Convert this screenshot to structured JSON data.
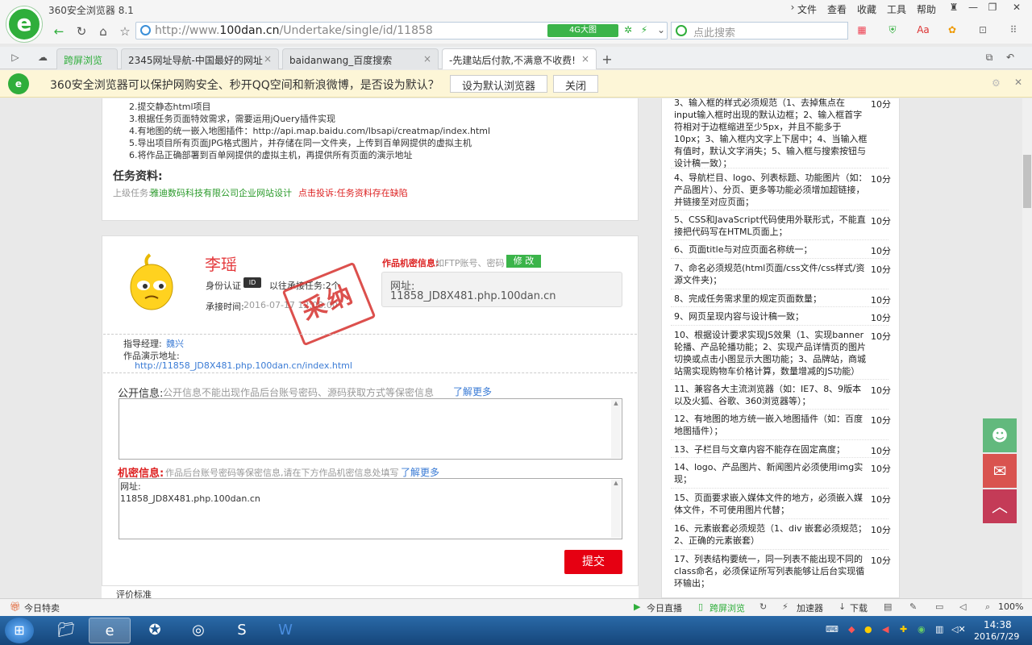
{
  "browser": {
    "title": "360安全浏览器 8.1",
    "menu": [
      "文件",
      "查看",
      "收藏",
      "工具",
      "帮助"
    ],
    "url_prefix": "http://www.",
    "url_domain": "100dan.cn",
    "url_path": "/Undertake/single/id/11858",
    "badge": "4G大图",
    "search_placeholder": "点此搜索",
    "tabs": [
      {
        "label": "跨屏浏览"
      },
      {
        "label": "2345网址导航-中国最好的网址"
      },
      {
        "label": "baidanwang_百度搜索"
      },
      {
        "label": "-先建站后付款,不满意不收费!"
      }
    ],
    "notice": "360安全浏览器可以保护网购安全、秒开QQ空间和新浪微博，是否设为默认？",
    "notice_btn_default": "设为默认浏览器",
    "notice_btn_close": "关闭"
  },
  "task": {
    "steps": [
      "2.提交静态html项目",
      "3.根据任务页面特效需求，需要运用jQuery插件实现",
      "4.有地图的统一嵌入地图插件：http://api.map.baidu.com/lbsapi/creatmap/index.html",
      "5.导出项目所有页面JPG格式图片，并存储在同一文件夹，上传到百单网提供的虚拟主机",
      "6.将作品正确部署到百单网提供的虚拟主机，再提供所有页面的演示地址"
    ],
    "materials_title": "任务资料:",
    "parent_label": "上级任务:",
    "parent_value": "雅迪数码科技有限公司企业网站设计",
    "complaint": "点击投诉:任务资料存在缺陷"
  },
  "submission": {
    "name": "李瑶",
    "identity_label": "身份认证",
    "past_tasks": "以往承接任务:2个",
    "time_label": "承接时间:",
    "time_value": "2016-07-17 12:08:00",
    "stamp": "采纳",
    "secret_label": "作品机密信息:",
    "secret_hint": "如FTP账号、密码",
    "edit_btn": "修 改",
    "url_label": "网址:",
    "url_value": "11858_JD8X481.php.100dan.cn",
    "manager_label": "指导经理:",
    "manager_value": "魏兴",
    "demo_label": "作品演示地址:",
    "demo_url": "http://11858_JD8X481.php.100dan.cn/index.html",
    "public_label": "公开信息:",
    "public_hint": "公开信息不能出现作品后台账号密码、源码获取方式等保密信息",
    "learn_more": "了解更多",
    "secret_info_label": "机密信息:",
    "secret_info_hint": "作品后台账号密码等保密信息,请在下方作品机密信息处填写",
    "secret_text_line1": "网址:",
    "secret_text_line2": "11858_JD8X481.php.100dan.cn",
    "submit": "提交",
    "bottom_partial": "评价标准"
  },
  "requirements": [
    {
      "text": "3、输入框的样式必须规范（1、去掉焦点在input输入框时出现的默认边框；2、输入框首字符相对于边框缩进至少5px，并且不能多于10px；3、输入框内文字上下居中；4、当输入框有值时，默认文字消失；5、输入框与搜索按钮与设计稿一致）；",
      "score": "10分"
    },
    {
      "text": "4、导航栏目、logo、列表标题、功能图片（如：产品图片）、分页、更多等功能必须增加超链接，并链接至对应页面；",
      "score": "10分"
    },
    {
      "text": "5、CSS和JavaScript代码使用外联形式，不能直接把代码写在HTML页面上；",
      "score": "10分"
    },
    {
      "text": "6、页面title与对应页面名称统一；",
      "score": "10分"
    },
    {
      "text": "7、命名必须规范(html页面/css文件/css样式/资源文件夹)；",
      "score": "10分"
    },
    {
      "text": "8、完成任务需求里的规定页面数量；",
      "score": "10分"
    },
    {
      "text": "9、网页呈现内容与设计稿一致；",
      "score": "10分"
    },
    {
      "text": "10、根据设计要求实现JS效果（1、实现banner轮播、产品轮播功能；2、实现产品详情页的图片切换或点击小图显示大图功能；3、品牌站，商城站需实现购物车价格计算，数量增减的JS功能）",
      "score": "10分"
    },
    {
      "text": "11、兼容各大主流浏览器（如：IE7、8、9版本以及火狐、谷歌、360浏览器等）；",
      "score": "10分"
    },
    {
      "text": "12、有地图的地方统一嵌入地图插件（如：百度地图插件）；",
      "score": "10分"
    },
    {
      "text": "13、子栏目与文章内容不能存在固定高度；",
      "score": "10分"
    },
    {
      "text": "14、logo、产品图片、新闻图片必须使用img实现；",
      "score": "10分"
    },
    {
      "text": "15、页面要求嵌入媒体文件的地方，必须嵌入媒体文件，不可使用图片代替；",
      "score": "10分"
    },
    {
      "text": "16、元素嵌套必须规范（1、div 嵌套必须规范；2、正确的元素嵌套）",
      "score": "10分"
    },
    {
      "text": "17、列表结构要统一，同一列表不能出现不同的class命名，必须保证所写列表能够让后台实现循环输出；",
      "score": "10分"
    }
  ],
  "statusbar": {
    "left": "今日特卖",
    "items": [
      "今日直播",
      "跨屏浏览",
      "加速器",
      "下载"
    ],
    "zoom": "100%"
  },
  "taskbar": {
    "time": "14:38",
    "date": "2016/7/29"
  }
}
